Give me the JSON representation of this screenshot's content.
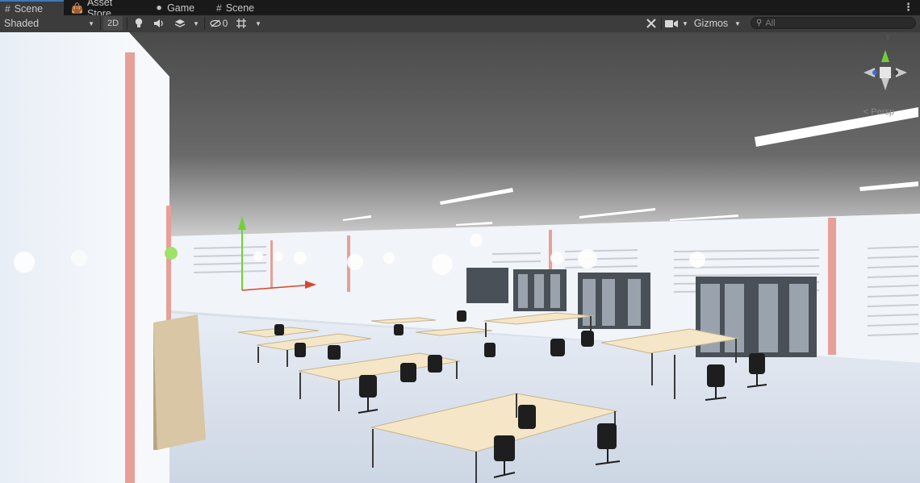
{
  "tabs": [
    {
      "label": "Scene",
      "icon": "grid-icon",
      "active": true
    },
    {
      "label": "Asset Store",
      "icon": "bag-icon",
      "active": false
    },
    {
      "label": "Game",
      "icon": "gamepad-icon",
      "active": false
    },
    {
      "label": "Scene",
      "icon": "grid-icon",
      "active": false
    }
  ],
  "toolbar": {
    "shading_mode": "Shaded",
    "mode_2d": "2D",
    "hidden_count": "0",
    "gizmos_label": "Gizmos",
    "search_placeholder": "All"
  },
  "viewport": {
    "orientation_label": "< Persp",
    "gizmo_axis_label": "y"
  },
  "colors": {
    "active_tab_accent": "#3a79bb",
    "toolbar_bg": "#3c3c3c",
    "gizmo_y": "#6fd13a",
    "gizmo_x": "#d8462b",
    "gizmo_z": "#3b6bd8"
  }
}
